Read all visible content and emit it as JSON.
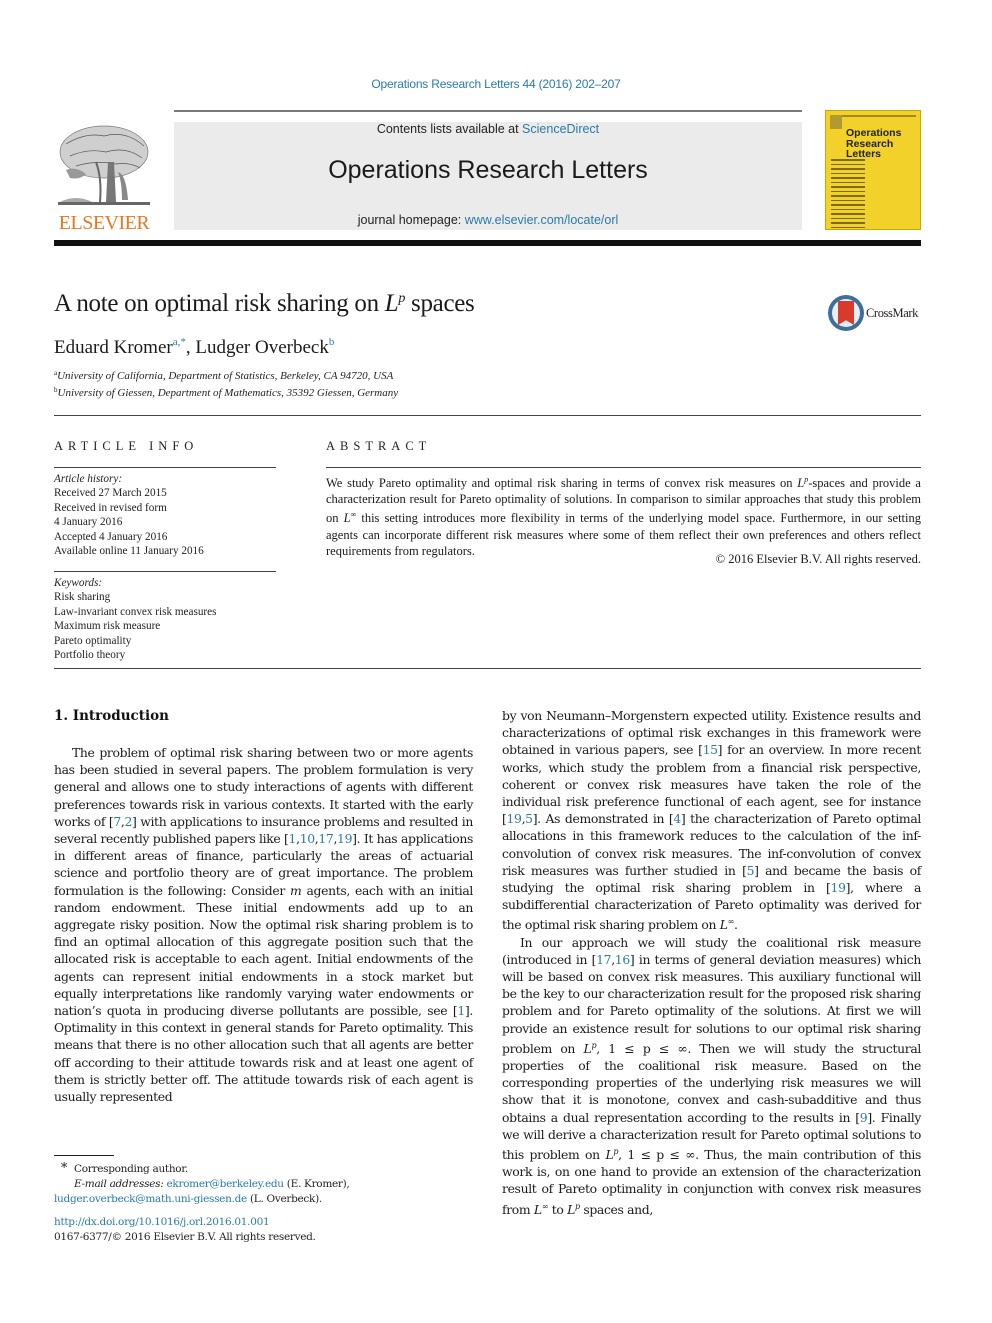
{
  "header": {
    "journal_ref": "Operations Research Letters 44 (2016) 202–207",
    "contents_prefix": "Contents lists available at ",
    "contents_link": "ScienceDirect",
    "journal_name": "Operations Research Letters",
    "homepage_prefix": "journal homepage: ",
    "homepage_link": "www.elsevier.com/locate/orl",
    "publisher_logo_text": "ELSEVIER",
    "cover_title_lines": [
      "Operations",
      "Research",
      "Letters"
    ],
    "crossmark_label": "CrossMark"
  },
  "article": {
    "title_prefix": "A note on optimal risk sharing on ",
    "title_L": "L",
    "title_sup": "p",
    "title_suffix": " spaces",
    "authors": [
      {
        "name": "Eduard Kromer",
        "marks": "a,*"
      },
      {
        "name": "Ludger Overbeck",
        "marks": "b"
      }
    ],
    "author_separator": ", ",
    "affiliations": [
      {
        "mark": "a",
        "text": "University of California, Department of Statistics, Berkeley, CA 94720, USA"
      },
      {
        "mark": "b",
        "text": "University of Giessen, Department of Mathematics, 35392 Giessen, Germany"
      }
    ]
  },
  "article_info": {
    "heading": "ARTICLE INFO",
    "history_label": "Article history:",
    "history": [
      "Received 27 March 2015",
      "Received in revised form",
      "4 January 2016",
      "Accepted 4 January 2016",
      "Available online 11 January 2016"
    ],
    "keywords_label": "Keywords:",
    "keywords": [
      "Risk sharing",
      "Law-invariant convex risk measures",
      "Maximum risk measure",
      "Pareto optimality",
      "Portfolio theory"
    ]
  },
  "abstract": {
    "heading": "ABSTRACT",
    "part1": "We study Pareto optimality and optimal risk sharing in terms of convex risk measures on ",
    "part2": "-spaces and provide a characterization result for Pareto optimality of solutions. In comparison to similar approaches that study this problem on ",
    "part3": " this setting introduces more flexibility in terms of the underlying model space. Furthermore, in our setting agents can incorporate different risk measures where some of them reflect their own preferences and others reflect requirements from regulators.",
    "copyright": "© 2016 Elsevier B.V. All rights reserved."
  },
  "section": {
    "heading": "1.  Introduction",
    "left_col": {
      "s1": "The problem of optimal risk sharing between two or more agents has been studied in several papers. The problem formulation is very general and allows one to study interactions of agents with different preferences towards risk in various contexts. It started with the early works of [",
      "r1": "7",
      "r2": "2",
      "s2": "] with applications to insurance problems and resulted in several recently published papers like [",
      "r3": "1",
      "r4": "10",
      "r5": "17",
      "r6": "19",
      "s3": "]. It has applications in different areas of finance, particularly the areas of actuarial science and portfolio theory are of great importance. The problem formulation is the following: Consider ",
      "m": "m",
      "s4": " agents, each with an initial random endowment. These initial endowments add up to an aggregate risky position. Now the optimal risk sharing problem is to find an optimal allocation of this aggregate position such that the allocated risk is acceptable to each agent. Initial endowments of the agents can represent initial endowments in a stock market but equally interpretations like randomly varying water endowments or nation’s quota in producing diverse pollutants are possible, see [",
      "r7": "1",
      "s5": "]. Optimality in this context in general stands for Pareto optimality. This means that there is no other allocation such that all agents are better off according to their attitude towards risk and at least one agent of them is strictly better off. The attitude towards risk of each agent is usually represented"
    },
    "right_col": {
      "p1_s1": "by von Neumann–Morgenstern expected utility. Existence results and characterizations of optimal risk exchanges in this framework were obtained in various papers, see [",
      "p1_r1": "15",
      "p1_s2": "] for an overview. In more recent works, which study the problem from a financial risk perspective, coherent or convex risk measures have taken the role of the individual risk preference functional of each agent, see for instance [",
      "p1_r2": "19",
      "p1_r3": "5",
      "p1_s3": "]. As demonstrated in [",
      "p1_r4": "4",
      "p1_s4": "] the characterization of Pareto optimal allocations in this framework reduces to the calculation of the inf-convolution of convex risk measures. The inf-convolution of convex risk measures was further studied in [",
      "p1_r5": "5",
      "p1_s5": "] and became the basis of studying the optimal risk sharing problem in [",
      "p1_r6": "19",
      "p1_s6": "], where a subdifferential characterization of Pareto optimality was derived for the optimal risk sharing problem on ",
      "p1_s7": ".",
      "p2_s1": "In our approach we will study the coalitional risk measure (introduced in [",
      "p2_r1": "17",
      "p2_r2": "16",
      "p2_s2": "] in terms of general deviation measures) which will be based on convex risk measures. This auxiliary functional will be the key to our characterization result for the proposed risk sharing problem and for Pareto optimality of the solutions. At first we will provide an existence result for solutions to our optimal risk sharing problem on ",
      "p2_s3": ", 1 ≤ p ≤ ∞. Then we will study the structural properties of the coalitional risk measure. Based on the corresponding properties of the underlying risk measures we will show that it is monotone, convex and cash-subadditive and thus obtains a dual representation according to the results in [",
      "p2_r3": "9",
      "p2_s4": "]. Finally we will derive a characterization result for Pareto optimal solutions to this problem on ",
      "p2_s5": ", 1 ≤ p ≤ ∞. Thus, the main contribution of this work is, on one hand to provide an extension of the characterization result of Pareto optimality in conjunction with convex risk measures from ",
      "p2_s6": " to ",
      "p2_s7": " spaces and,"
    },
    "math": {
      "L": "L",
      "p": "p",
      "inf": "∞"
    }
  },
  "footnotes": {
    "star": "*",
    "corresponding": "Corresponding author.",
    "email_label": "E-mail addresses: ",
    "email1": "ekromer@berkeley.edu",
    "email1_name": " (E. Kromer),",
    "email2": "ludger.overbeck@math.uni-giessen.de",
    "email2_name": " (L. Overbeck).",
    "doi": "http://dx.doi.org/10.1016/j.orl.2016.01.001",
    "issn_copyright": "0167-6377/© 2016 Elsevier B.V. All rights reserved."
  },
  "colors": {
    "link": "#2a7aaa",
    "elsevier_orange": "#e87722",
    "cover_yellow": "#f2d22a",
    "header_gray": "#ebebeb"
  }
}
